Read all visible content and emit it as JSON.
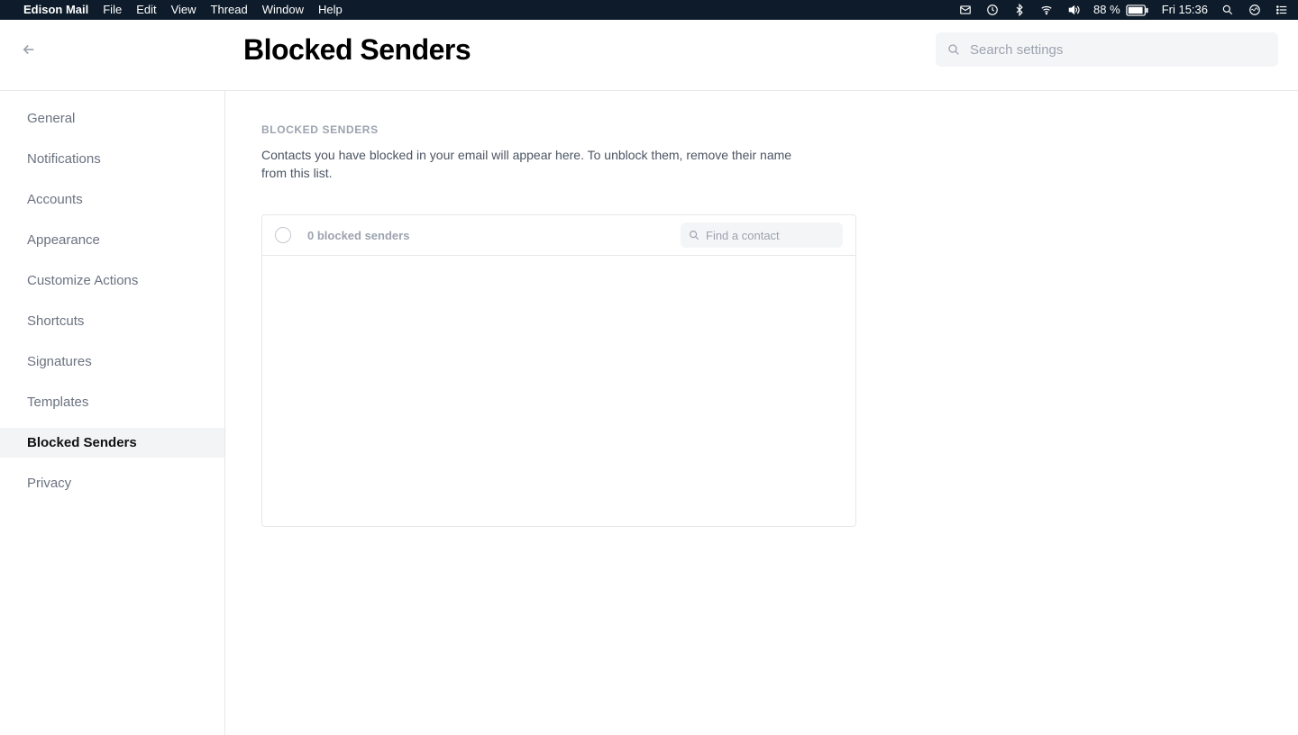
{
  "menubar": {
    "app_name": "Edison Mail",
    "items": [
      "File",
      "Edit",
      "View",
      "Thread",
      "Window",
      "Help"
    ],
    "battery_percent": "88 %",
    "clock": "Fri 15:36"
  },
  "header": {
    "title": "Blocked Senders",
    "search_placeholder": "Search settings"
  },
  "sidebar": {
    "items": [
      {
        "label": "General",
        "active": false
      },
      {
        "label": "Notifications",
        "active": false
      },
      {
        "label": "Accounts",
        "active": false
      },
      {
        "label": "Appearance",
        "active": false
      },
      {
        "label": "Customize Actions",
        "active": false
      },
      {
        "label": "Shortcuts",
        "active": false
      },
      {
        "label": "Signatures",
        "active": false
      },
      {
        "label": "Templates",
        "active": false
      },
      {
        "label": "Blocked Senders",
        "active": true
      },
      {
        "label": "Privacy",
        "active": false
      }
    ]
  },
  "main": {
    "section_label": "BLOCKED SENDERS",
    "section_desc": "Contacts you have blocked in your email will appear here. To unblock them, remove their name from this list.",
    "count_label": "0 blocked senders",
    "find_placeholder": "Find a contact"
  }
}
